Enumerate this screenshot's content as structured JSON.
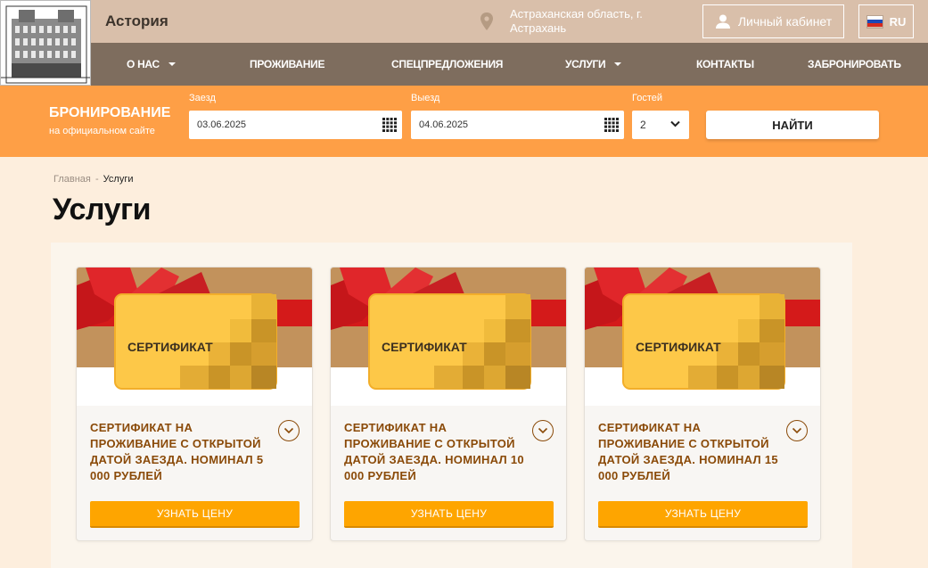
{
  "header": {
    "hotel_name": "Астория",
    "location_line1": "Астраханская область, г.",
    "location_line2": "Астрахань",
    "cabinet_label": "Личный кабинет",
    "lang": "RU"
  },
  "nav": [
    {
      "label": "О НАС",
      "dropdown": true
    },
    {
      "label": "ПРОЖИВАНИЕ",
      "dropdown": false
    },
    {
      "label": "СПЕЦПРЕДЛОЖЕНИЯ",
      "dropdown": false
    },
    {
      "label": "УСЛУГИ",
      "dropdown": true
    },
    {
      "label": "КОНТАКТЫ",
      "dropdown": false
    },
    {
      "label": "ЗАБРОНИРОВАТЬ",
      "dropdown": false
    }
  ],
  "booking": {
    "title": "БРОНИРОВАНИЕ",
    "subtitle": "на официальном сайте",
    "checkin_label": "Заезд",
    "checkin_value": "03.06.2025",
    "checkout_label": "Выезд",
    "checkout_value": "04.06.2025",
    "guests_label": "Гостей",
    "guests_value": "2",
    "search_label": "НАЙТИ"
  },
  "breadcrumb": {
    "home": "Главная",
    "separator": "-",
    "current": "Услуги"
  },
  "page_title": "Услуги",
  "cards": [
    {
      "image_text": "СЕРТИФИКАТ",
      "title": "СЕРТИФИКАТ НА ПРОЖИВАНИЕ С ОТКРЫТОЙ ДАТОЙ ЗАЕЗДА. НОМИНАЛ 5 000 РУБЛЕЙ",
      "button": "УЗНАТЬ ЦЕНУ"
    },
    {
      "image_text": "СЕРТИФИКАТ",
      "title": "СЕРТИФИКАТ НА ПРОЖИВАНИЕ С ОТКРЫТОЙ ДАТОЙ ЗАЕЗДА. НОМИНАЛ 10 000 РУБЛЕЙ",
      "button": "УЗНАТЬ ЦЕНУ"
    },
    {
      "image_text": "СЕРТИФИКАТ",
      "title": "СЕРТИФИКАТ НА ПРОЖИВАНИЕ С ОТКРЫТОЙ ДАТОЙ ЗАЕЗДА. НОМИНАЛ 15 000 РУБЛЕЙ",
      "button": "УЗНАТЬ ЦЕНУ"
    }
  ],
  "icons": {
    "location": "map-pin-icon",
    "cabinet": "user-icon",
    "calendar": "calendar-grid-icon",
    "select": "chevron-down-icon",
    "expand": "chevron-down-circle-icon"
  },
  "colors": {
    "topbar": "#d9bfaa",
    "nav": "#7e6d5e",
    "booking": "#fe9f46",
    "background": "#fdeedd",
    "accent_button": "#fea500",
    "card_title": "#8a4a08"
  }
}
